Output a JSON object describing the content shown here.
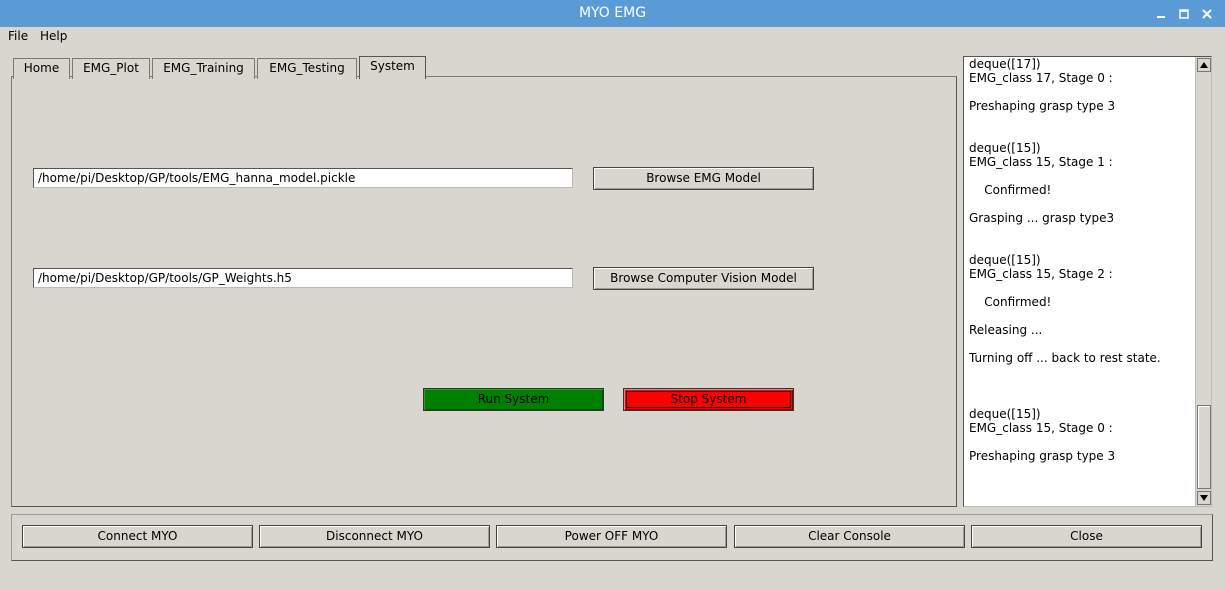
{
  "window": {
    "title": "MYO EMG",
    "controls": [
      "minimize-icon",
      "maximize-icon",
      "close-icon"
    ]
  },
  "menu": {
    "file": "File",
    "help": "Help"
  },
  "tabs": [
    "Home",
    "EMG_Plot",
    "EMG_Training",
    "EMG_Testing",
    "System"
  ],
  "active_tab": "System",
  "system": {
    "emg_model_path": "/home/pi/Desktop/GP/tools/EMG_hanna_model.pickle",
    "browse_emg_label": "Browse EMG Model",
    "cv_model_path": "/home/pi/Desktop/GP/tools/GP_Weights.h5",
    "browse_cv_label": "Browse Computer Vision Model",
    "run_label": "Run System",
    "stop_label": "Stop System"
  },
  "console": {
    "lines": [
      "deque([17])",
      "EMG_class 17, Stage 0 :",
      "",
      "Preshaping grasp type 3",
      "",
      "",
      "deque([15])",
      "EMG_class 15, Stage 1 :",
      "",
      "    Confirmed!",
      "",
      "Grasping ... grasp type3",
      "",
      "",
      "deque([15])",
      "EMG_class 15, Stage 2 :",
      "",
      "    Confirmed!",
      "",
      "Releasing ...",
      "",
      "Turning off ... back to rest state.",
      "",
      "",
      "",
      "deque([15])",
      "EMG_class 15, Stage 0 :",
      "",
      "Preshaping grasp type 3"
    ]
  },
  "bottom_buttons": {
    "connect": "Connect MYO",
    "disconnect": "Disconnect MYO",
    "power_off": "Power OFF MYO",
    "clear_console": "Clear Console",
    "close": "Close"
  },
  "colors": {
    "titlebar": "#5b9bd5",
    "run_button": "#008000",
    "stop_button": "#ff0000"
  }
}
